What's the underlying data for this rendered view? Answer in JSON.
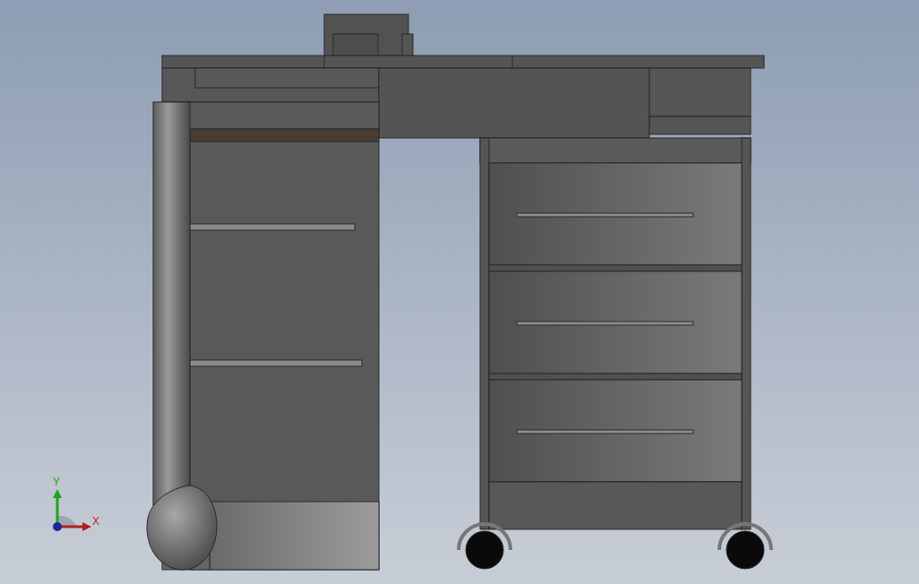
{
  "viewport": {
    "triad": [
      {
        "kind": "y",
        "label": "Y"
      },
      {
        "kind": "x",
        "label": "X"
      }
    ]
  }
}
